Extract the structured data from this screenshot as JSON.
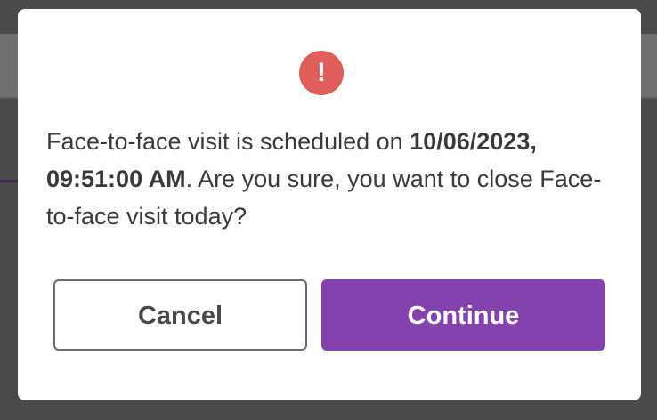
{
  "dialog": {
    "icon": "alert-exclamation-icon",
    "icon_glyph": "!",
    "icon_color": "#df5d5a",
    "message_prefix": "Face-to-face visit is scheduled on ",
    "message_datetime": "10/06/2023, 09:51:00 AM",
    "message_suffix": ". Are you sure, you want to close Face-to-face visit today?",
    "cancel_label": "Cancel",
    "continue_label": "Continue",
    "accent_color": "#8342ae"
  }
}
